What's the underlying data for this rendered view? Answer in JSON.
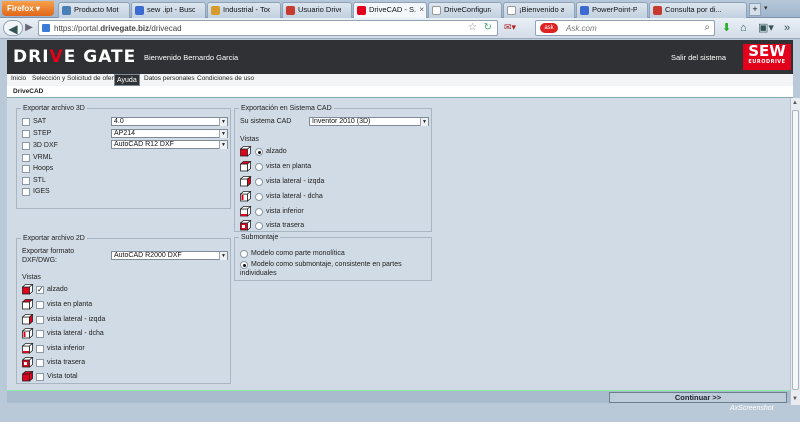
{
  "browser": {
    "app_button": "Firefox",
    "tabs": [
      {
        "label": "Producto Motor...",
        "color": "#4a7fb5"
      },
      {
        "label": "sew .ipt - Buscar...",
        "color": "#3b6ad0"
      },
      {
        "label": "Industrial - Tool...",
        "color": "#d79b2d"
      },
      {
        "label": "Usuario DriveGa...",
        "color": "#c63a30"
      },
      {
        "label": "DriveCAD - S...",
        "color": "#e2001a"
      },
      {
        "label": "DriveConfigurat...",
        "color": "#ffffff"
      },
      {
        "label": "¡Bienvenido a Dr...",
        "color": "#ffffff"
      },
      {
        "label": "PowerPoint-Prá...",
        "color": "#3b6ad0"
      },
      {
        "label": "Consulta por di...",
        "color": "#c63a30"
      }
    ],
    "new_tab": "+",
    "url_prefix": "https://portal.",
    "url_domain": "drivegate.biz",
    "url_path": "/drivecad",
    "search_placeholder": "Ask.com",
    "search_engine": "ask"
  },
  "header": {
    "logo_a": "DRI",
    "logo_v": "V",
    "logo_b": "E GATE",
    "welcome": "Bienvenido Bernardo Garcia",
    "logout": "Salir del sistema",
    "brand": "SEW",
    "brand_sub": "EURODRIVE"
  },
  "menu": {
    "items": [
      "Inicio",
      "Selección y Solicitud de oferta",
      "Ayuda",
      "Datos personales",
      "Condiciones de uso"
    ],
    "selected": "Ayuda"
  },
  "page_title": "DriveCAD",
  "export3d": {
    "legend": "Exportar archivo 3D",
    "formats": [
      {
        "label": "SAT",
        "checked": false,
        "version": "4.0"
      },
      {
        "label": "STEP",
        "checked": false,
        "version": "AP214"
      },
      {
        "label": "3D DXF",
        "checked": false,
        "version": "AutoCAD R12 DXF"
      },
      {
        "label": "VRML",
        "checked": false
      },
      {
        "label": "Hoops",
        "checked": false
      },
      {
        "label": "STL",
        "checked": false
      },
      {
        "label": "IGES",
        "checked": false
      }
    ]
  },
  "cadsystem": {
    "legend": "Exportación en Sistema CAD",
    "system_label": "Su sistema CAD",
    "system_value": "Inventor 2010 (3D)",
    "views_label": "Vistas",
    "views": [
      {
        "label": "alzado",
        "selected": true
      },
      {
        "label": "vista en planta",
        "selected": false
      },
      {
        "label": "vista lateral - izqda",
        "selected": false
      },
      {
        "label": "vista lateral - dcha",
        "selected": false
      },
      {
        "label": "vista inferior",
        "selected": false
      },
      {
        "label": "vista trasera",
        "selected": false
      }
    ]
  },
  "submontaje": {
    "legend": "Submontaje",
    "options": [
      {
        "label": "Modelo como parte monolítica",
        "selected": false
      },
      {
        "label_line1": "Modelo como submontaje, consistente en partes",
        "label_line2": "individuales",
        "selected": true
      }
    ]
  },
  "export2d": {
    "legend": "Exportar archivo 2D",
    "format_label_1": "Exportar formato",
    "format_label_2": "DXF/DWG:",
    "format_value": "AutoCAD R2000 DXF",
    "views_label": "Vistas",
    "views": [
      {
        "label": "alzado",
        "checked": true
      },
      {
        "label": "vista en planta",
        "checked": false
      },
      {
        "label": "vista lateral - izqda",
        "checked": false
      },
      {
        "label": "vista lateral - dcha",
        "checked": false
      },
      {
        "label": "vista inferior",
        "checked": false
      },
      {
        "label": "vista trasera",
        "checked": false
      },
      {
        "label": "Vista total",
        "checked": false
      }
    ]
  },
  "footer": {
    "continue": "Continuar >>",
    "watermark": "AxScreenshot"
  },
  "colors": {
    "brand_red": "#e2001a",
    "header_dark": "#2f3134",
    "content_bg": "#d0dbe5"
  }
}
